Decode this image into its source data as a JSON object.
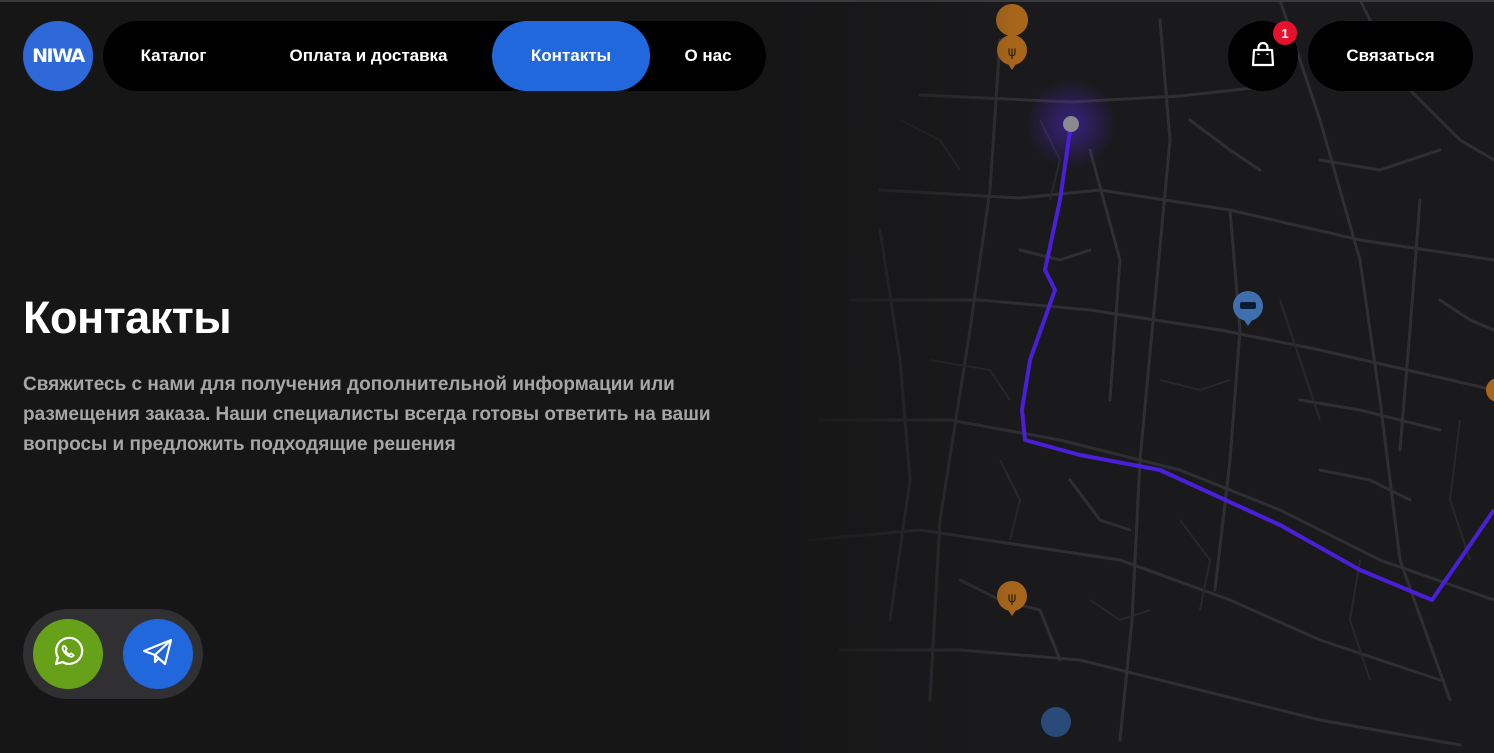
{
  "brand": {
    "logo_text": "NIWA",
    "accent": "#2168dc"
  },
  "nav": {
    "items": [
      {
        "label": "Каталог",
        "active": false
      },
      {
        "label": "Оплата и доставка",
        "active": false
      },
      {
        "label": "Контакты",
        "active": true
      },
      {
        "label": "О нас",
        "active": false
      }
    ]
  },
  "header": {
    "cart_icon": "shopping-bag-icon",
    "cart_count": "1",
    "contact_label": "Связаться"
  },
  "hero": {
    "title": "Контакты",
    "description": "Свяжитесь с нами для получения дополнительной информации или размещения заказа. Наши специалисты всегда готовы ответить на ваши вопросы и предложить подходящие решения"
  },
  "social": {
    "whatsapp_icon": "whatsapp-icon",
    "whatsapp_color": "#66a119",
    "telegram_icon": "telegram-icon",
    "telegram_color": "#2168dc"
  },
  "map": {
    "route_color": "#4b1fd9",
    "pois": [
      "restaurant-icon",
      "hotel-icon",
      "restaurant-icon",
      "place-icon"
    ]
  }
}
